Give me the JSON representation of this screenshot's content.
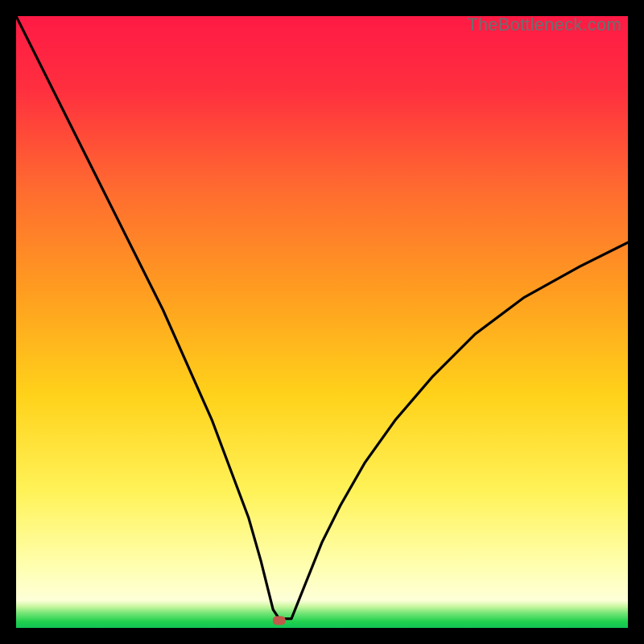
{
  "watermark": "TheBottleneck.com",
  "chart_data": {
    "type": "line",
    "title": "",
    "xlabel": "",
    "ylabel": "",
    "xlim": [
      0,
      100
    ],
    "ylim": [
      0,
      100
    ],
    "grid": false,
    "legend": false,
    "annotations": [],
    "bottom_band": {
      "description": "thin green strip at y≈0 indicating optimal zone",
      "y_range": [
        0,
        2.5
      ]
    },
    "marker": {
      "x": 43,
      "y": 1.2,
      "shape": "rounded-rect",
      "color": "#c05a4a",
      "note": "small red marker at curve minimum"
    },
    "background_gradient": {
      "description": "vertical heat gradient from red (top) through orange/yellow to pale-yellow, with green strip at bottom",
      "stops": [
        {
          "offset": 0.0,
          "color": "#ff1a45"
        },
        {
          "offset": 0.12,
          "color": "#ff2f3f"
        },
        {
          "offset": 0.28,
          "color": "#ff6a30"
        },
        {
          "offset": 0.45,
          "color": "#ff9d20"
        },
        {
          "offset": 0.62,
          "color": "#ffd21a"
        },
        {
          "offset": 0.78,
          "color": "#fff35a"
        },
        {
          "offset": 0.9,
          "color": "#ffffb0"
        },
        {
          "offset": 0.955,
          "color": "#fdffd8"
        },
        {
          "offset": 0.965,
          "color": "#c9f7a0"
        },
        {
          "offset": 0.975,
          "color": "#7ae67a"
        },
        {
          "offset": 0.99,
          "color": "#1fd14c"
        },
        {
          "offset": 1.0,
          "color": "#11c455"
        }
      ]
    },
    "series": [
      {
        "name": "bottleneck-curve",
        "note": "V-shaped curve; y is bottleneck %, minimum near x≈43",
        "x": [
          0,
          4,
          8,
          12,
          16,
          20,
          24,
          28,
          32,
          35,
          38,
          40,
          41,
          42,
          43,
          45,
          46,
          48,
          50,
          53,
          57,
          62,
          68,
          75,
          83,
          92,
          100
        ],
        "y": [
          100,
          92,
          84,
          76,
          68,
          60,
          52,
          43,
          34,
          26,
          18,
          11,
          7,
          3,
          1.5,
          1.5,
          4,
          9,
          14,
          20,
          27,
          34,
          41,
          48,
          54,
          59,
          63
        ]
      }
    ]
  }
}
